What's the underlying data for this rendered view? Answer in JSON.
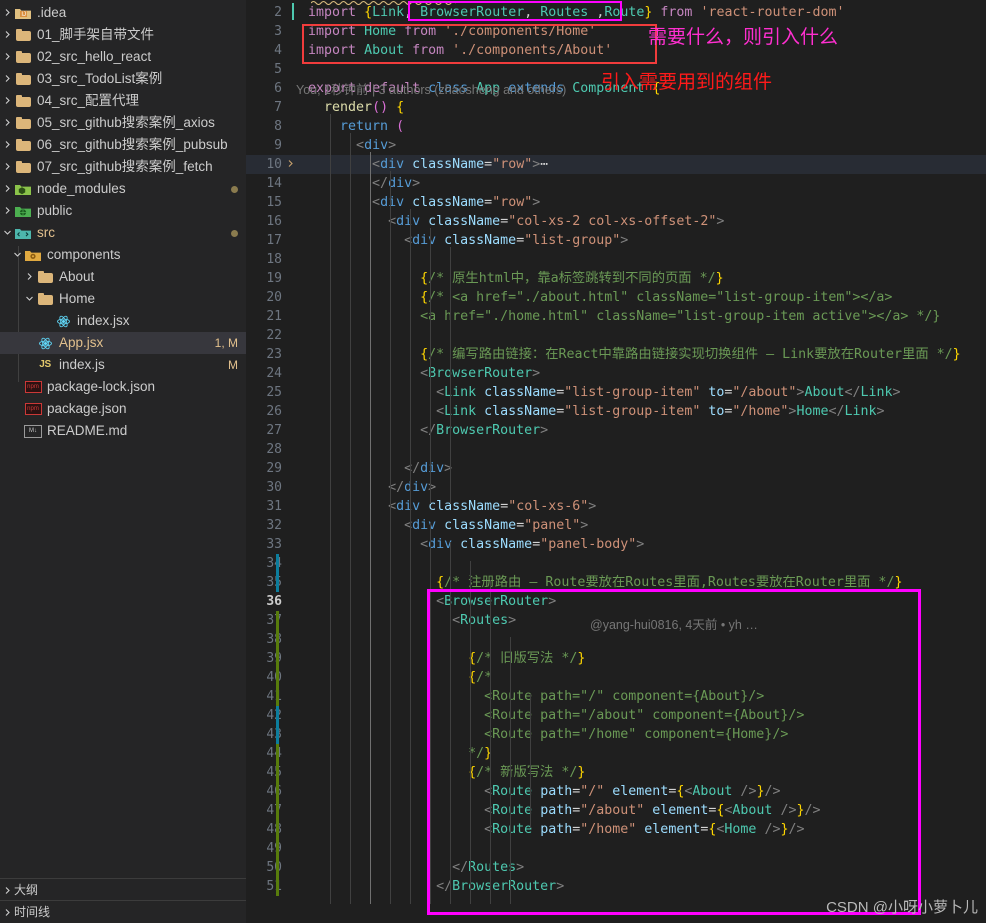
{
  "sidebar": {
    "items": [
      {
        "label": ".idea",
        "icon": "folder-idea-icon",
        "indent": 0,
        "twisty": "chevron-right",
        "badge": "",
        "selected": false
      },
      {
        "label": "01_脚手架自带文件",
        "icon": "folder-icon",
        "indent": 0,
        "twisty": "chevron-right",
        "badge": "",
        "selected": false
      },
      {
        "label": "02_src_hello_react",
        "icon": "folder-icon",
        "indent": 0,
        "twisty": "chevron-right",
        "badge": "",
        "selected": false
      },
      {
        "label": "03_src_TodoList案例",
        "icon": "folder-icon",
        "indent": 0,
        "twisty": "chevron-right",
        "badge": "",
        "selected": false
      },
      {
        "label": "04_src_配置代理",
        "icon": "folder-icon",
        "indent": 0,
        "twisty": "chevron-right",
        "badge": "",
        "selected": false
      },
      {
        "label": "05_src_github搜索案例_axios",
        "icon": "folder-icon",
        "indent": 0,
        "twisty": "chevron-right",
        "badge": "",
        "selected": false
      },
      {
        "label": "06_src_github搜索案例_pubsub",
        "icon": "folder-icon",
        "indent": 0,
        "twisty": "chevron-right",
        "badge": "",
        "selected": false
      },
      {
        "label": "07_src_github搜索案例_fetch",
        "icon": "folder-icon",
        "indent": 0,
        "twisty": "chevron-right",
        "badge": "",
        "selected": false
      },
      {
        "label": "node_modules",
        "icon": "folder-node-icon",
        "indent": 0,
        "twisty": "chevron-right",
        "badge": "dot",
        "selected": false
      },
      {
        "label": "public",
        "icon": "folder-public-icon",
        "indent": 0,
        "twisty": "chevron-right",
        "badge": "",
        "selected": false
      },
      {
        "label": "src",
        "icon": "folder-src-icon",
        "indent": 0,
        "twisty": "chevron-down",
        "badge": "dot",
        "selected": false,
        "amber": true
      },
      {
        "label": "components",
        "icon": "folder-components-icon",
        "indent": 1,
        "twisty": "chevron-down",
        "badge": "",
        "selected": false
      },
      {
        "label": "About",
        "icon": "folder-icon",
        "indent": 2,
        "twisty": "chevron-right",
        "badge": "",
        "selected": false
      },
      {
        "label": "Home",
        "icon": "folder-icon",
        "indent": 2,
        "twisty": "chevron-down",
        "badge": "",
        "selected": false
      },
      {
        "label": "index.jsx",
        "icon": "react-icon",
        "indent": 3,
        "twisty": "",
        "badge": "",
        "selected": false
      },
      {
        "label": "App.jsx",
        "icon": "react-icon",
        "indent": 2,
        "twisty": "",
        "badge": "1, M",
        "selected": true,
        "amber": true
      },
      {
        "label": "index.js",
        "icon": "js-icon",
        "indent": 2,
        "twisty": "",
        "badge": "M",
        "selected": false
      },
      {
        "label": "package-lock.json",
        "icon": "npm-icon",
        "indent": 1,
        "twisty": "",
        "badge": "",
        "selected": false
      },
      {
        "label": "package.json",
        "icon": "npm-icon",
        "indent": 1,
        "twisty": "",
        "badge": "",
        "selected": false
      },
      {
        "label": "README.md",
        "icon": "markdown-icon",
        "indent": 1,
        "twisty": "",
        "badge": "",
        "selected": false
      }
    ],
    "outline_label": "大纲",
    "timeline_label": "时间线"
  },
  "editor": {
    "blame": "You, 1秒钟前 | 3 authors (zhaosheng and others)",
    "inline_blame": "@yang-hui0816, 4天前 • yh …",
    "lines": [
      {
        "no": "2",
        "text": "import {Link, BrowserRouter, Routes ,Route} from 'react-router-dom'"
      },
      {
        "no": "3",
        "text": "import Home from './components/Home'"
      },
      {
        "no": "4",
        "text": "import About from './components/About'"
      },
      {
        "no": "5",
        "text": ""
      },
      {
        "no": "6",
        "text": "export default class App extends Component {"
      },
      {
        "no": "7",
        "text": "  render() {"
      },
      {
        "no": "8",
        "text": "    return ("
      },
      {
        "no": "9",
        "text": "      <div>"
      },
      {
        "no": "10",
        "text": "        <div className=\"row\">⋯"
      },
      {
        "no": "14",
        "text": "        </div>"
      },
      {
        "no": "15",
        "text": "        <div className=\"row\">"
      },
      {
        "no": "16",
        "text": "          <div className=\"col-xs-2 col-xs-offset-2\">"
      },
      {
        "no": "17",
        "text": "            <div className=\"list-group\">"
      },
      {
        "no": "18",
        "text": ""
      },
      {
        "no": "19",
        "text": "              {/* 原生html中，靠a标签跳转到不同的页面 */}"
      },
      {
        "no": "20",
        "text": "              {/* <a href=\"./about.html\" className=\"list-group-item\"></a>"
      },
      {
        "no": "21",
        "text": "              <a href=\"./home.html\" className=\"list-group-item active\"></a> */}"
      },
      {
        "no": "22",
        "text": ""
      },
      {
        "no": "23",
        "text": "              {/* 编写路由链接：在React中靠路由链接实现切换组件 — Link要放在Router里面 */}"
      },
      {
        "no": "24",
        "text": "              <BrowserRouter>"
      },
      {
        "no": "25",
        "text": "                <Link className=\"list-group-item\" to=\"/about\">About</Link>"
      },
      {
        "no": "26",
        "text": "                <Link className=\"list-group-item\" to=\"/home\">Home</Link>"
      },
      {
        "no": "27",
        "text": "              </BrowserRouter>"
      },
      {
        "no": "28",
        "text": ""
      },
      {
        "no": "29",
        "text": "            </div>"
      },
      {
        "no": "30",
        "text": "          </div>"
      },
      {
        "no": "31",
        "text": "          <div className=\"col-xs-6\">"
      },
      {
        "no": "32",
        "text": "            <div className=\"panel\">"
      },
      {
        "no": "33",
        "text": "              <div className=\"panel-body\">"
      },
      {
        "no": "34",
        "text": ""
      },
      {
        "no": "35",
        "text": "                {/* 注册路由 — Route要放在Routes里面,Routes要放在Router里面 */}"
      },
      {
        "no": "36",
        "text": "                <BrowserRouter>"
      },
      {
        "no": "37",
        "text": "                  <Routes>"
      },
      {
        "no": "38",
        "text": ""
      },
      {
        "no": "39",
        "text": "                    {/* 旧版写法 */}"
      },
      {
        "no": "40",
        "text": "                    {/*"
      },
      {
        "no": "41",
        "text": "                      <Route path=\"/\" component={About}/>"
      },
      {
        "no": "42",
        "text": "                      <Route path=\"/about\" component={About}/>"
      },
      {
        "no": "43",
        "text": "                      <Route path=\"/home\" component={Home}/>"
      },
      {
        "no": "44",
        "text": "                    */}"
      },
      {
        "no": "45",
        "text": "                    {/* 新版写法 */}"
      },
      {
        "no": "46",
        "text": "                      <Route path=\"/\" element={<About />}/>"
      },
      {
        "no": "47",
        "text": "                      <Route path=\"/about\" element={<About />}/>"
      },
      {
        "no": "48",
        "text": "                      <Route path=\"/home\" element={<Home />}/>"
      },
      {
        "no": "49",
        "text": ""
      },
      {
        "no": "50",
        "text": "                  </Routes>"
      },
      {
        "no": "51",
        "text": "                </BrowserRouter>"
      }
    ]
  },
  "annotations": {
    "note_magenta": "需要什么，则引入什么",
    "note_red": "引入需要用到的组件",
    "watermark": "CSDN @小呀小萝卜儿"
  },
  "colors": {
    "accent_magenta": "#ff00ff",
    "accent_red": "#f03c3c",
    "note_magenta": "#ff2fd0",
    "note_red": "#ff1a1a",
    "selection_bg": "#37373d",
    "editor_bg": "#1f1f1f",
    "sidebar_bg": "#252526"
  }
}
